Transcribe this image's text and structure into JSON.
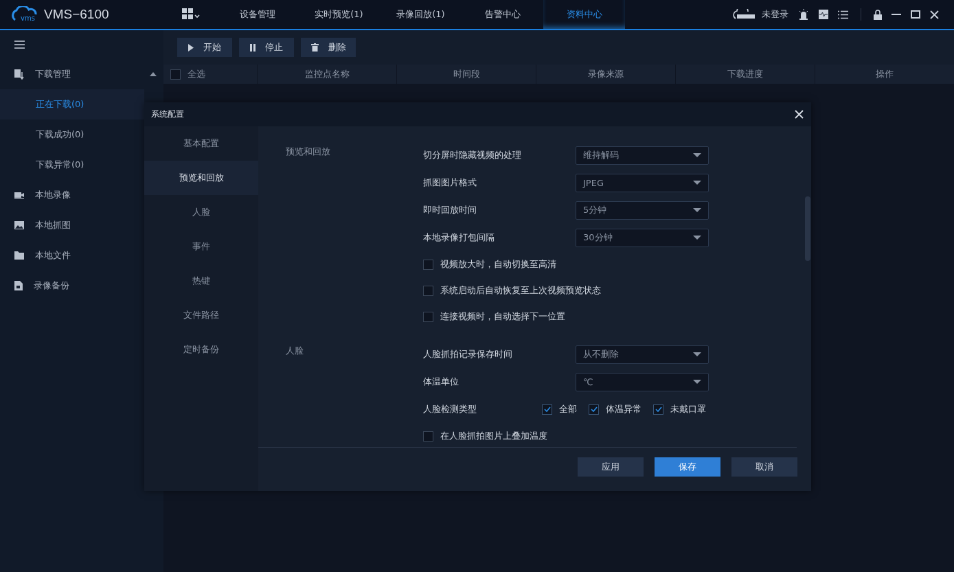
{
  "app": {
    "logo_text": "vms",
    "title": "VMS−6100"
  },
  "nav": [
    {
      "label": "设备管理",
      "selected": false
    },
    {
      "label": "实时预览(1)",
      "selected": false
    },
    {
      "label": "录像回放(1)",
      "selected": false
    },
    {
      "label": "告警中心",
      "selected": false
    },
    {
      "label": "资料中心",
      "selected": true
    }
  ],
  "user": {
    "status": "未登录"
  },
  "sidebar": {
    "items": [
      {
        "label": "下载管理",
        "expanded": true,
        "children": [
          {
            "label": "正在下载(0)",
            "selected": true
          },
          {
            "label": "下载成功(0)",
            "selected": false
          },
          {
            "label": "下载异常(0)",
            "selected": false
          }
        ]
      },
      {
        "label": "本地录像"
      },
      {
        "label": "本地抓图"
      },
      {
        "label": "本地文件"
      },
      {
        "label": "录像备份"
      }
    ]
  },
  "toolbar": {
    "buttons": [
      "开始",
      "停止",
      "删除"
    ]
  },
  "table": {
    "select_all": {
      "label": "全选",
      "checked": false
    },
    "columns": [
      "监控点名称",
      "时间段",
      "录像来源",
      "下载进度",
      "操作"
    ]
  },
  "dialog": {
    "title": "系统配置",
    "tabs": [
      {
        "label": "基本配置",
        "selected": false
      },
      {
        "label": "预览和回放",
        "selected": true
      },
      {
        "label": "人脸",
        "selected": false
      },
      {
        "label": "事件",
        "selected": false
      },
      {
        "label": "热键",
        "selected": false
      },
      {
        "label": "文件路径",
        "selected": false
      },
      {
        "label": "定时备份",
        "selected": false
      }
    ],
    "sections": [
      {
        "title": "预览和回放",
        "rows": [
          {
            "kind": "select",
            "label": "切分屏时隐藏视频的处理",
            "value": "维持解码"
          },
          {
            "kind": "select",
            "label": "抓图图片格式",
            "value": "JPEG"
          },
          {
            "kind": "select",
            "label": "即时回放时间",
            "value": "5分钟"
          },
          {
            "kind": "select",
            "label": "本地录像打包间隔",
            "value": "30分钟"
          },
          {
            "kind": "checkbox",
            "label": "视频放大时，自动切换至高清",
            "checked": false
          },
          {
            "kind": "checkbox",
            "label": "系统启动后自动恢复至上次视频预览状态",
            "checked": false
          },
          {
            "kind": "checkbox",
            "label": "连接视频时，自动选择下一位置",
            "checked": false
          }
        ]
      },
      {
        "title": "人脸",
        "rows": [
          {
            "kind": "select",
            "label": "人脸抓拍记录保存时间",
            "value": "从不删除"
          },
          {
            "kind": "select",
            "label": "体温单位",
            "value": "℃"
          },
          {
            "kind": "checkgroup",
            "label": "人脸检测类型",
            "options": [
              {
                "label": "全部",
                "checked": true
              },
              {
                "label": "体温异常",
                "checked": true
              },
              {
                "label": "未戴口罩",
                "checked": true
              }
            ]
          },
          {
            "kind": "checkbox",
            "label": "在人脸抓拍图片上叠加温度",
            "checked": false
          }
        ]
      }
    ],
    "buttons": [
      {
        "label": "应用",
        "primary": false
      },
      {
        "label": "保存",
        "primary": true
      },
      {
        "label": "取消",
        "primary": false
      }
    ]
  }
}
